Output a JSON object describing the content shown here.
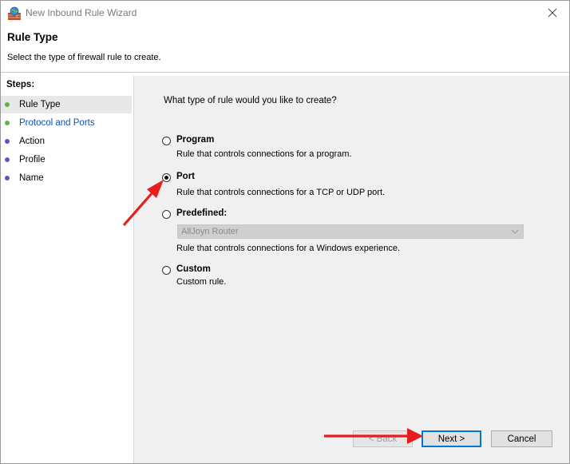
{
  "window": {
    "title": "New Inbound Rule Wizard"
  },
  "header": {
    "title": "Rule Type",
    "description": "Select the type of firewall rule to create."
  },
  "steps": {
    "heading": "Steps:",
    "items": [
      {
        "label": "Rule Type",
        "state": "current",
        "dot_color": "#5fb246"
      },
      {
        "label": "Protocol and Ports",
        "state": "link",
        "dot_color": "#5fb246"
      },
      {
        "label": "Action",
        "state": "pending",
        "dot_color": "#5a55c8"
      },
      {
        "label": "Profile",
        "state": "pending",
        "dot_color": "#5a55c8"
      },
      {
        "label": "Name",
        "state": "pending",
        "dot_color": "#5a55c8"
      }
    ]
  },
  "main": {
    "question": "What type of rule would you like to create?",
    "options": [
      {
        "title": "Program",
        "description": "Rule that controls connections for a program.",
        "checked": false
      },
      {
        "title": "Port",
        "description": "Rule that controls connections for a TCP or UDP port.",
        "checked": true
      },
      {
        "title": "Predefined:",
        "description": "Rule that controls connections for a Windows experience.",
        "checked": false
      },
      {
        "title": "Custom",
        "description": "Custom rule.",
        "checked": false
      }
    ],
    "predefined_dropdown": {
      "value": "AllJoyn Router",
      "enabled": false
    }
  },
  "buttons": {
    "back": "< Back",
    "next": "Next >",
    "cancel": "Cancel"
  },
  "colors": {
    "annotation_arrow": "#e81c1c",
    "link_text": "#0a50b4",
    "default_button_border": "#0078d7"
  },
  "icons": {
    "title": "firewall-globe-icon",
    "close": "close-icon",
    "dropdown": "chevron-down-icon"
  }
}
